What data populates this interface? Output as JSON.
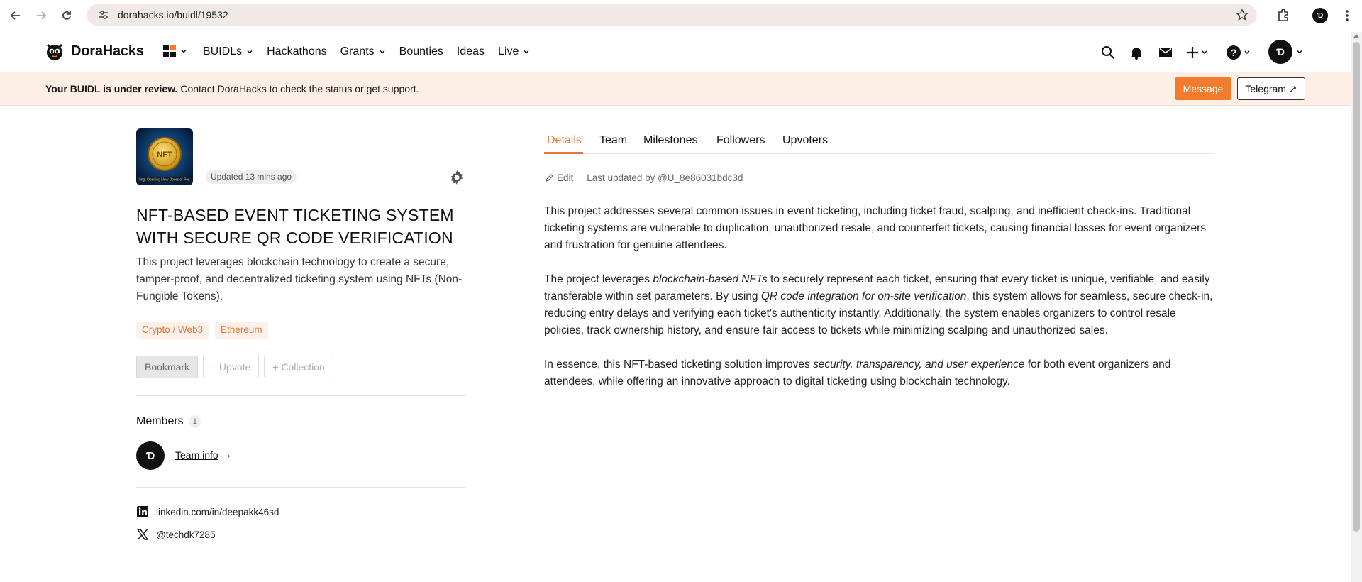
{
  "browser": {
    "url": "dorahacks.io/buidl/19532",
    "profile_initial": "Ɗ"
  },
  "header": {
    "brand": "DoraHacks",
    "nav": [
      {
        "label": "BUIDLs",
        "has_menu": true
      },
      {
        "label": "Hackathons",
        "has_menu": false
      },
      {
        "label": "Grants",
        "has_menu": true
      },
      {
        "label": "Bounties",
        "has_menu": false
      },
      {
        "label": "Ideas",
        "has_menu": false
      },
      {
        "label": "Live",
        "has_menu": true
      }
    ],
    "avatar_initial": "Ɗ"
  },
  "banner": {
    "bold": "Your BUIDL is under review.",
    "text": " Contact DoraHacks to check the status or get support.",
    "message_label": "Message",
    "telegram_label": "Telegram ↗"
  },
  "project": {
    "updated": "Updated 13 mins ago",
    "title": "NFT-BASED EVENT TICKETING SYSTEM WITH SECURE QR CODE VERIFICATION",
    "description": "This project leverages blockchain technology to create a secure, tamper-proof, and decentralized ticketing system using NFTs (Non-Fungible Tokens).",
    "tags": [
      "Crypto / Web3",
      "Ethereum"
    ],
    "actions": {
      "bookmark": "Bookmark",
      "upvote": "↑ Upvote",
      "collection": "+ Collection"
    },
    "members_label": "Members",
    "members_count": "1",
    "member_initial": "Ɗ",
    "team_info": "Team info",
    "team_arrow": "→",
    "linkedin": "linkedin.com/in/deepakk46sd",
    "twitter": "@techdk7285"
  },
  "tabs": {
    "details": "Details",
    "team": "Team",
    "milestones": "Milestones",
    "followers": "Followers",
    "upvoters": "Upvoters"
  },
  "meta": {
    "edit": "Edit",
    "last_updated": "Last updated by @U_8e86031bdc3d"
  },
  "content": {
    "p1": "This project addresses several common issues in event ticketing, including ticket fraud, scalping, and inefficient check-ins. Traditional ticketing systems are vulnerable to duplication, unauthorized resale, and counterfeit tickets, causing financial losses for event organizers and frustration for genuine attendees.",
    "p2_a": "The project leverages ",
    "p2_em1": "blockchain-based NFTs",
    "p2_b": " to securely represent each ticket, ensuring that every ticket is unique, verifiable, and easily transferable within set parameters. By using ",
    "p2_em2": "QR code integration for on-site verification",
    "p2_c": ", this system allows for seamless, secure check-in, reducing entry delays and verifying each ticket's authenticity instantly. Additionally, the system enables organizers to control resale policies, track ownership history, and ensure fair access to tickets while minimizing scalping and unauthorized sales.",
    "p3_a": "In essence, this NFT-based ticketing solution improves ",
    "p3_em": "security, transparency, and user experience",
    "p3_b": " for both event organizers and attendees, while offering an innovative approach to digital ticketing using blockchain technology."
  },
  "colors": {
    "accent": "#f47b2c",
    "banner_bg": "#fdeee6",
    "tag_bg": "#fdf0e9",
    "tag_text": "#e0793a"
  }
}
